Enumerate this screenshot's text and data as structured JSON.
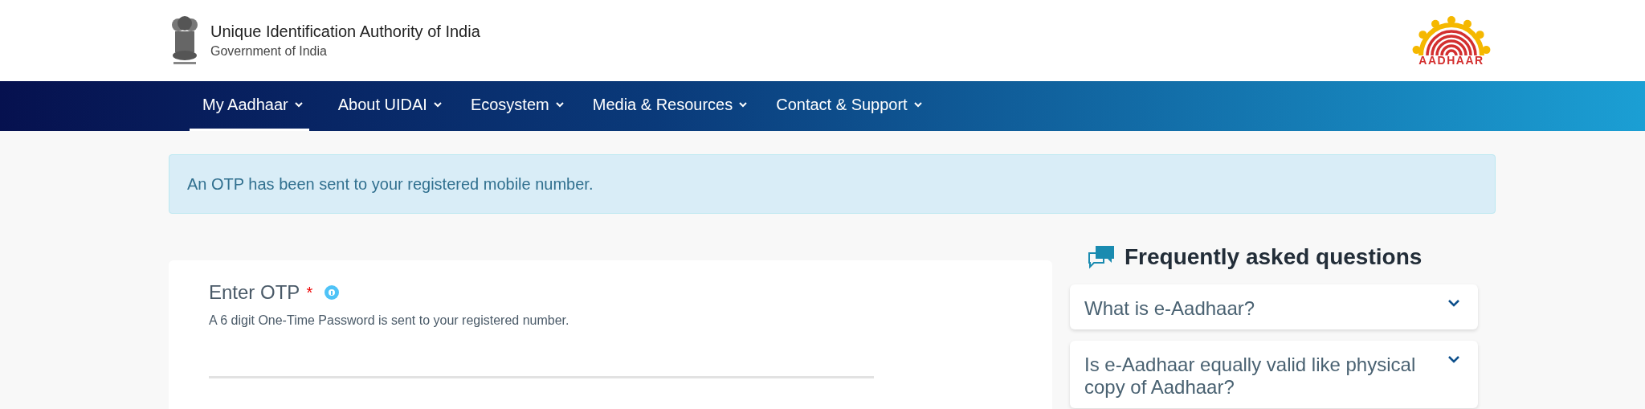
{
  "header": {
    "title": "Unique Identification Authority of India",
    "subtitle": "Government of India",
    "logo_text": "AADHAAR"
  },
  "nav": [
    {
      "label": "My Aadhaar",
      "selected": true
    },
    {
      "label": "About UIDAI",
      "selected": false
    },
    {
      "label": "Ecosystem",
      "selected": false
    },
    {
      "label": "Media & Resources",
      "selected": false
    },
    {
      "label": "Contact & Support",
      "selected": false
    }
  ],
  "alert": "An OTP has been sent to your registered mobile number.",
  "otp": {
    "label": "Enter OTP",
    "required_mark": "*",
    "hint": "A 6 digit One-Time Password is sent to your registered number."
  },
  "faq": {
    "title": "Frequently asked questions",
    "items": [
      {
        "question": "What is e-Aadhaar?",
        "expanded": false
      },
      {
        "question": "Is e-Aadhaar equally valid like physical copy of Aadhaar?",
        "expanded": false
      }
    ]
  }
}
